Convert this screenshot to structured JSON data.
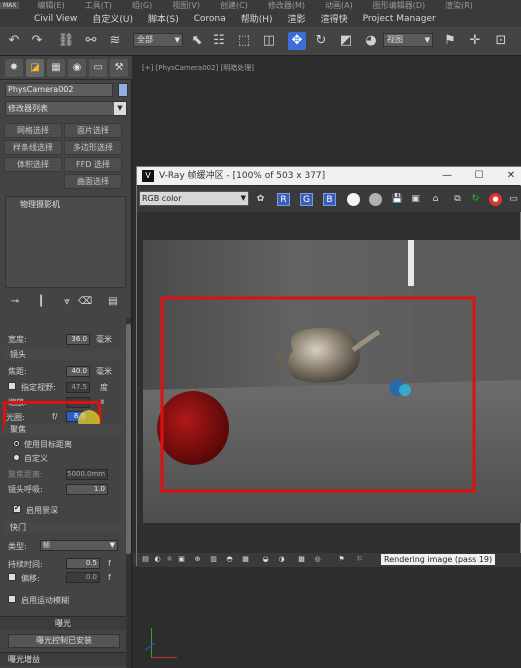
{
  "menubar_top": {
    "logo": "MAX",
    "items": [
      "编辑(E)",
      "工具(T)",
      "组(G)",
      "视图(V)",
      "创建(C)",
      "修改器(M)",
      "动画(A)",
      "图形编辑器(D)",
      "渲染(R)"
    ]
  },
  "menubar": {
    "items": [
      "Civil View",
      "自定义(U)",
      "脚本(S)",
      "Corona",
      "帮助(H)",
      "渲影",
      "渲得快",
      "Project Manager"
    ]
  },
  "toolbar": {
    "selection_filter": "全部",
    "coord_system": "视图"
  },
  "command_panel": {
    "object_name": "PhysCamera002",
    "object_color": "#8db0e6",
    "modifier_list": "修改器列表",
    "modifier_buttons": [
      "网格选择",
      "面片选择",
      "样条线选择",
      "多边形选择",
      "体积选择",
      "FFD 选择",
      "曲面选择"
    ],
    "stack_item": "物理摄影机"
  },
  "params": {
    "width_label": "宽度:",
    "width_value": "36.0",
    "width_unit": "毫米",
    "lens_section": "镜头",
    "focal_label": "焦距:",
    "focal_value": "40.0",
    "focal_unit": "毫米",
    "fov_label": "指定视野:",
    "fov_value": "47.5",
    "fov_unit": "度",
    "zoom_label": "缩放:",
    "zoom_unit": "x",
    "aperture_label": "光圈:",
    "aperture_prefix": "f/",
    "aperture_value": "8.0",
    "focus_section": "聚焦",
    "use_target": "使用目标距离",
    "custom": "自定义",
    "focus_dist_label": "聚焦距离:",
    "focus_dist_value": "5000.0mm",
    "lens_breath_label": "镜头呼吸:",
    "lens_breath_value": "1.0",
    "dof_label": "启用景深",
    "shutter_section": "快门",
    "type_label": "类型:",
    "type_value": "帧",
    "duration_label": "持续时间:",
    "duration_value": "0.5",
    "duration_unit": "f",
    "offset_label": "偏移:",
    "offset_value": "0.0",
    "offset_unit": "f",
    "motion_blur_label": "启用运动模糊",
    "exposure_rollout": "曝光",
    "exposure_button": "曝光控制已安装",
    "exposure_gain": "曝光增益"
  },
  "viewport": {
    "label": "[+] [PhysCamera002] [明暗处理]"
  },
  "vfb": {
    "title": "V-Ray 帧缓冲区 - [100% of 503 x 377]",
    "channel": "RGB color",
    "status": "Rendering image (pass 19)",
    "minimize": "—",
    "maximize": "☐",
    "close": "✕"
  }
}
